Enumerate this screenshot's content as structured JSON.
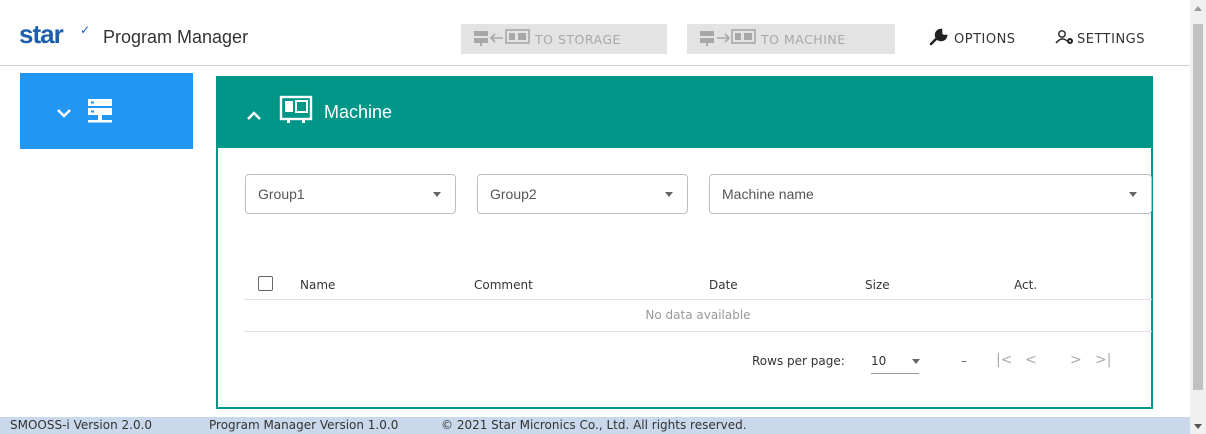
{
  "header": {
    "logo": "star",
    "logo_mark": "✓",
    "app_title": "Program Manager",
    "to_storage_label": "TO STORAGE",
    "to_machine_label": "TO MACHINE",
    "options_label": "OPTIONS",
    "settings_label": "SETTINGS"
  },
  "sidebar": {
    "items": [
      {
        "icon": "chevron-down-icon",
        "secondary_icon": "server-icon",
        "selected": true
      }
    ]
  },
  "panel": {
    "title": "Machine",
    "filters": {
      "group1": "Group1",
      "group2": "Group2",
      "machine_name": "Machine name"
    },
    "table": {
      "columns": [
        "Name",
        "Comment",
        "Date",
        "Size",
        "Act."
      ],
      "empty_text": "No data available"
    },
    "pagination": {
      "rows_per_page_label": "Rows per page:",
      "rows_per_page": "10",
      "range": "–"
    }
  },
  "footer": {
    "smooss_version": "SMOOSS-i Version 2.0.0",
    "pm_version": "Program Manager Version 1.0.0",
    "copyright": "© 2021 Star Micronics Co., Ltd. All rights reserved."
  },
  "colors": {
    "brand": "#1b5fad",
    "teal": "#009688",
    "blue": "#2196f3",
    "footer_bg": "#c9d8ea"
  }
}
